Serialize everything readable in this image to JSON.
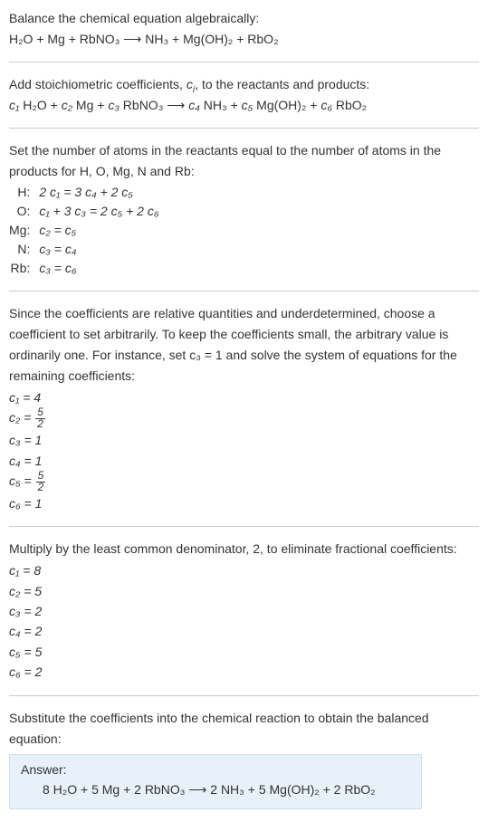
{
  "intro": {
    "line1": "Balance the chemical equation algebraically:",
    "eq": "H₂O + Mg + RbNO₃ ⟶ NH₃ + Mg(OH)₂ + RbO₂"
  },
  "stoich": {
    "line1_a": "Add stoichiometric coefficients, ",
    "line1_c": "c",
    "line1_i": "i",
    "line1_b": ", to the reactants and products:",
    "eq_c1": "c₁",
    "eq_h2o": " H₂O + ",
    "eq_c2": "c₂",
    "eq_mg": " Mg + ",
    "eq_c3": "c₃",
    "eq_rbno3": " RbNO₃ ⟶ ",
    "eq_c4": "c₄",
    "eq_nh3": " NH₃ + ",
    "eq_c5": "c₅",
    "eq_mgoh2": " Mg(OH)₂ + ",
    "eq_c6": "c₆",
    "eq_rbo2": " RbO₂"
  },
  "atoms": {
    "intro1": "Set the number of atoms in the reactants equal to the number of atoms in the",
    "intro2": "products for H, O, Mg, N and Rb:",
    "rows": [
      {
        "el": "H:",
        "eq": "2 c₁ = 3 c₄ + 2 c₅"
      },
      {
        "el": "O:",
        "eq": "c₁ + 3 c₃ = 2 c₅ + 2 c₆"
      },
      {
        "el": "Mg:",
        "eq": "c₂ = c₅"
      },
      {
        "el": "N:",
        "eq": "c₃ = c₄"
      },
      {
        "el": "Rb:",
        "eq": "c₃ = c₆"
      }
    ]
  },
  "solve": {
    "para1": "Since the coefficients are relative quantities and underdetermined, choose a",
    "para2": "coefficient to set arbitrarily. To keep the coefficients small, the arbitrary value is",
    "para3": "ordinarily one. For instance, set c₃ = 1 and solve the system of equations for the",
    "para4": "remaining coefficients:",
    "c1": "c₁ = 4",
    "c2_a": "c₂ = ",
    "c2_num": "5",
    "c2_den": "2",
    "c3": "c₃ = 1",
    "c4": "c₄ = 1",
    "c5_a": "c₅ = ",
    "c5_num": "5",
    "c5_den": "2",
    "c6": "c₆ = 1"
  },
  "mult": {
    "intro": "Multiply by the least common denominator, 2, to eliminate fractional coefficients:",
    "c1": "c₁ = 8",
    "c2": "c₂ = 5",
    "c3": "c₃ = 2",
    "c4": "c₄ = 2",
    "c5": "c₅ = 5",
    "c6": "c₆ = 2"
  },
  "subst": {
    "line1": "Substitute the coefficients into the chemical reaction to obtain the balanced",
    "line2": "equation:"
  },
  "answer": {
    "label": "Answer:",
    "eq": "8 H₂O + 5 Mg + 2 RbNO₃ ⟶ 2 NH₃ + 5 Mg(OH)₂ + 2 RbO₂"
  }
}
